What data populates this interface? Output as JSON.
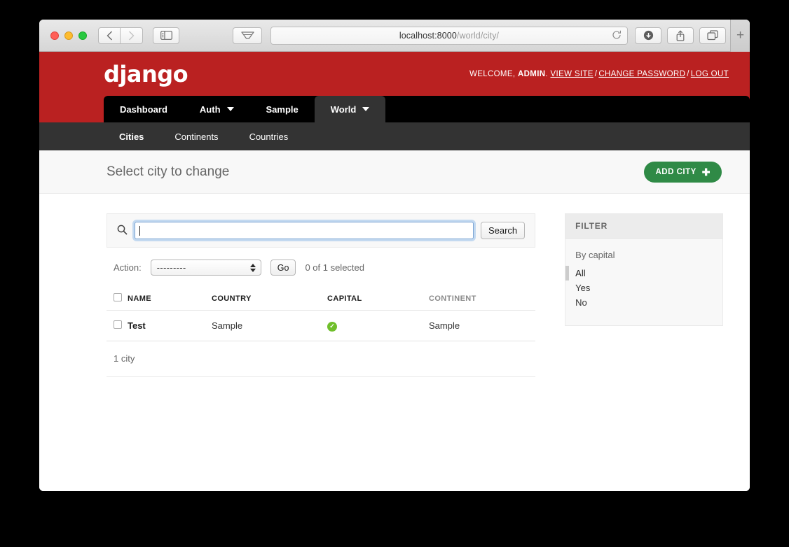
{
  "browser": {
    "url_host": "localhost:8000",
    "url_path": "/world/city/",
    "reload_icon": "reload-icon",
    "back_icon": "back-chevron-icon",
    "forward_icon": "forward-chevron-icon",
    "sidebar_icon": "sidebar-toggle-icon",
    "reader_icon": "reader-view-icon",
    "downloads_icon": "downloads-icon",
    "share_icon": "share-icon",
    "tabs_icon": "tab-overview-icon",
    "new_tab_label": "+"
  },
  "header": {
    "logo": "django",
    "welcome_prefix": "WELCOME, ",
    "username": "ADMIN",
    "welcome_suffix": ".",
    "links": {
      "view_site": "VIEW SITE",
      "change_password": "CHANGE PASSWORD",
      "log_out": "LOG OUT"
    },
    "separator": "/",
    "brand_color": "#ba2121"
  },
  "main_nav": [
    {
      "label": "Dashboard",
      "has_caret": false,
      "active": false
    },
    {
      "label": "Auth",
      "has_caret": true,
      "active": false
    },
    {
      "label": "Sample",
      "has_caret": false,
      "active": false
    },
    {
      "label": "World",
      "has_caret": true,
      "active": true
    }
  ],
  "sub_nav": [
    {
      "label": "Cities",
      "active": true
    },
    {
      "label": "Continents",
      "active": false
    },
    {
      "label": "Countries",
      "active": false
    }
  ],
  "page": {
    "title": "Select city to change",
    "add_button": "ADD CITY",
    "add_button_plus": "✚",
    "add_button_color": "#2f8a46"
  },
  "search": {
    "value": "",
    "placeholder": "",
    "button_label": "Search",
    "icon": "search-icon"
  },
  "actions": {
    "label": "Action:",
    "selected_option": "---------",
    "options": [
      "---------"
    ],
    "go_label": "Go",
    "selection_count": "0 of 1 selected"
  },
  "results_table": {
    "columns": [
      {
        "label": "NAME",
        "muted": false
      },
      {
        "label": "COUNTRY",
        "muted": false
      },
      {
        "label": "CAPITAL",
        "muted": false
      },
      {
        "label": "CONTINENT",
        "muted": true
      }
    ],
    "rows": [
      {
        "selected": false,
        "name": "Test",
        "country": "Sample",
        "capital": true,
        "capital_icon": "check-circle-icon",
        "continent": "Sample"
      }
    ]
  },
  "paginator": {
    "count_text": "1 city"
  },
  "filter": {
    "heading": "FILTER",
    "groups": [
      {
        "title": "By capital",
        "options": [
          {
            "label": "All",
            "selected": true
          },
          {
            "label": "Yes",
            "selected": false
          },
          {
            "label": "No",
            "selected": false
          }
        ]
      }
    ]
  }
}
